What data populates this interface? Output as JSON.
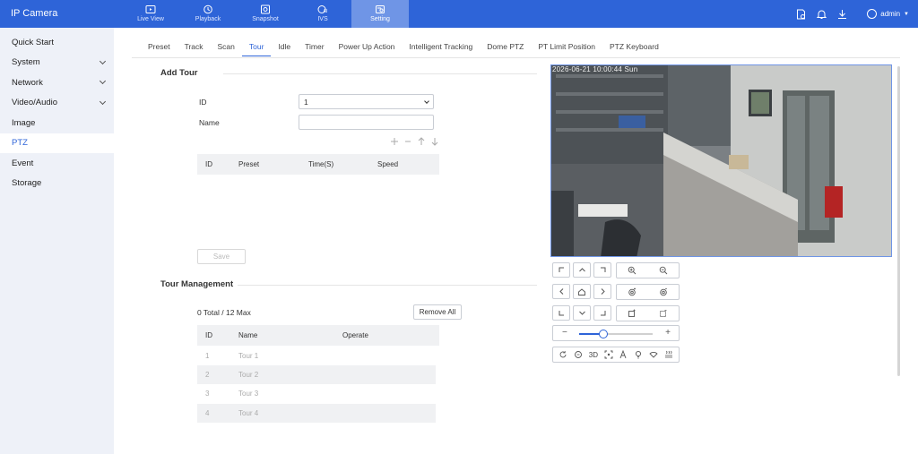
{
  "app": {
    "title": "IP Camera"
  },
  "nav": [
    {
      "label": "Live View",
      "icon": "live-view-icon"
    },
    {
      "label": "Playback",
      "icon": "playback-icon"
    },
    {
      "label": "Snapshot",
      "icon": "snapshot-icon"
    },
    {
      "label": "IVS",
      "icon": "ivs-icon"
    },
    {
      "label": "Setting",
      "icon": "setting-icon",
      "active": true
    }
  ],
  "user": {
    "name": "admin"
  },
  "sidebar": {
    "items": [
      {
        "label": "Quick Start"
      },
      {
        "label": "System",
        "expandable": true
      },
      {
        "label": "Network",
        "expandable": true
      },
      {
        "label": "Video/Audio",
        "expandable": true
      },
      {
        "label": "Image"
      },
      {
        "label": "PTZ",
        "active": true
      },
      {
        "label": "Event"
      },
      {
        "label": "Storage"
      }
    ]
  },
  "tabs": [
    "Preset",
    "Track",
    "Scan",
    "Tour",
    "Idle",
    "Timer",
    "Power Up Action",
    "Intelligent Tracking",
    "Dome PTZ",
    "PT Limit Position",
    "PTZ Keyboard"
  ],
  "active_tab": "Tour",
  "add_tour": {
    "title": "Add Tour",
    "id_label": "ID",
    "id_value": "1",
    "name_label": "Name",
    "name_value": "",
    "table_headers": [
      "ID",
      "Preset",
      "Time(S)",
      "Speed"
    ],
    "save_label": "Save"
  },
  "tour_management": {
    "title": "Tour Management",
    "count_text": "0 Total / 12 Max",
    "remove_all_label": "Remove All",
    "table_headers": [
      "ID",
      "Name",
      "Operate"
    ],
    "rows": [
      {
        "id": "1",
        "name": "Tour 1"
      },
      {
        "id": "2",
        "name": "Tour 2"
      },
      {
        "id": "3",
        "name": "Tour 3"
      },
      {
        "id": "4",
        "name": "Tour 4"
      }
    ]
  },
  "video": {
    "timestamp": "2026-06-21 10:00:44 Sun"
  },
  "ptz": {
    "zoom_level": 0.33,
    "three_d_label": "3D"
  },
  "colors": {
    "accent": "#2e64d8",
    "topbar": "#2e64d8",
    "nav_active": "#6f95e6",
    "sidebar_bg": "#eef1f8"
  }
}
